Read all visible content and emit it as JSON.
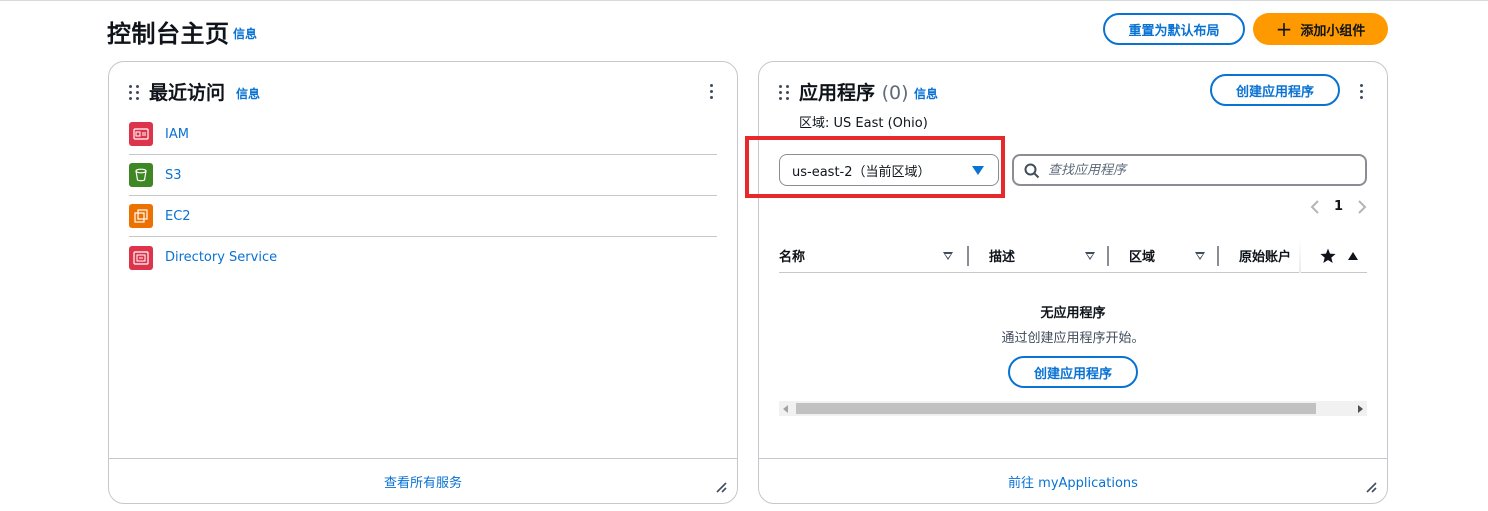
{
  "header": {
    "title": "控制台主页",
    "info": "信息",
    "reset_button": "重置为默认布局",
    "add_widget_button": "添加小组件",
    "add_widget_glyph": "+"
  },
  "recent": {
    "title": "最近访问",
    "info": "信息",
    "items": [
      {
        "label": "IAM",
        "icon": "iam-icon",
        "color": "#dd344c"
      },
      {
        "label": "S3",
        "icon": "s3-bucket-icon",
        "color": "#3f8624"
      },
      {
        "label": "EC2",
        "icon": "ec2-icon",
        "color": "#ed7100"
      },
      {
        "label": "Directory Service",
        "icon": "directory-service-icon",
        "color": "#dd344c"
      }
    ],
    "footer_link": "查看所有服务"
  },
  "apps": {
    "title": "应用程序",
    "count": "(0)",
    "info": "信息",
    "create_button": "创建应用程序",
    "region_label": "区域: US East (Ohio)",
    "region_select": "us-east-2（当前区域）",
    "search_placeholder": "查找应用程序",
    "page": "1",
    "columns": [
      "名称",
      "描述",
      "区域",
      "原始账户"
    ],
    "empty_title": "无应用程序",
    "empty_sub": "通过创建应用程序开始。",
    "empty_button": "创建应用程序",
    "footer_link": "前往 myApplications"
  },
  "colors": {
    "link": "#0972d3",
    "primary": "#ff9900",
    "highlight": "#e8292c"
  }
}
